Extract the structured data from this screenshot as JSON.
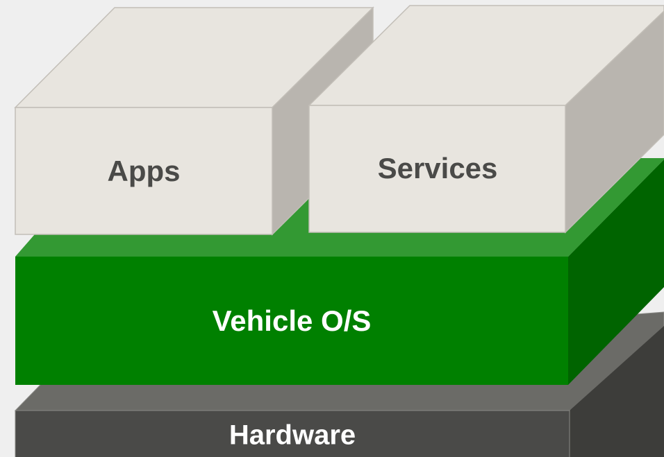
{
  "diagram": {
    "layers": [
      {
        "id": "hardware",
        "label": "Hardware",
        "colors": {
          "front": "#4a4a48",
          "top": "#6b6b67",
          "side": "#3d3d3a",
          "text": "#ffffff"
        }
      },
      {
        "id": "vehicle-os",
        "label": "Vehicle O/S",
        "colors": {
          "front": "#008000",
          "top": "#339933",
          "side": "#006400",
          "text": "#ffffff"
        }
      },
      {
        "id": "apps",
        "label": "Apps",
        "colors": {
          "front": "#e8e5df",
          "top": "#e8e5df",
          "side": "#b9b5af",
          "text": "#4a4a48"
        }
      },
      {
        "id": "services",
        "label": "Services",
        "colors": {
          "front": "#e8e5df",
          "top": "#e8e5df",
          "side": "#b9b5af",
          "text": "#4a4a48"
        }
      }
    ]
  }
}
